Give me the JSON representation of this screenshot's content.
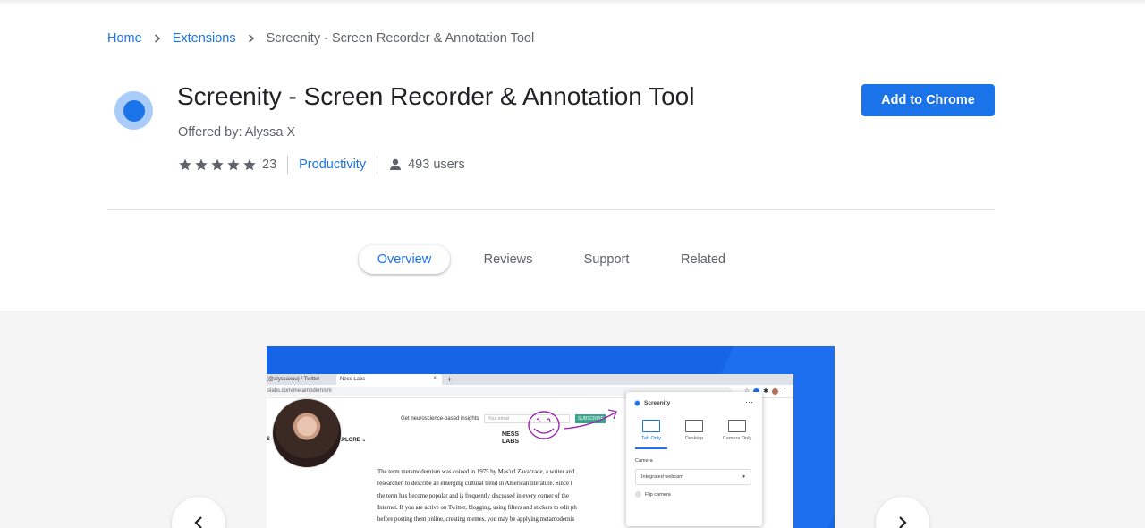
{
  "breadcrumb": {
    "home": "Home",
    "extensions": "Extensions",
    "current": "Screenity - Screen Recorder & Annotation Tool"
  },
  "extension": {
    "title": "Screenity - Screen Recorder & Annotation Tool",
    "offered_by": "Offered by: Alyssa X",
    "rating_stars": 5,
    "rating_count": "23",
    "category": "Productivity",
    "users": "493 users",
    "add_button": "Add to Chrome",
    "icon": "screenity-logo-icon"
  },
  "tabs": [
    "Overview",
    "Reviews",
    "Support",
    "Related"
  ],
  "active_tab": "Overview",
  "screenshot": {
    "tab1": "(@alyssaxuu) / Twitter",
    "tab2": "Ness Labs",
    "url": "slabs.com/metamodernism",
    "newsletter_text": "Get neuroscience-based insights",
    "email_placeholder": "Your email",
    "subscribe": "SUBSCRIBE",
    "logo_line1": "NESS",
    "logo_line2": "LABS",
    "explore": "EXPLORE",
    "explore_prefix": "S",
    "article_lines": [
      "The term metamodernism was coined in 1975 by Mas'ud Zavarzade, a writer and",
      "researcher, to describe an emerging cultural trend in American literature. Since t",
      "the term has become popular and is frequently discussed in every corner of the",
      "Internet. If you are active on Twitter, blogging, using filters and stickers to edit ph",
      "before posting them online, creating memes, you may be applying metamodernis"
    ],
    "popup": {
      "title": "Screenity",
      "more": "···",
      "modes": [
        "Tab Only",
        "Desktop",
        "Camera Only"
      ],
      "selected_mode": "Tab Only",
      "camera_label": "Camera",
      "camera_value": "Integrated webcam",
      "flip_label": "Flip camera"
    }
  },
  "gallery_nav": {
    "prev_icon": "chevron-left-icon",
    "next_icon": "chevron-right-icon"
  },
  "colors": {
    "accent": "#1a73e8",
    "gallery_bg": "#f5f5f5",
    "slide_bg": "#1565e6"
  }
}
